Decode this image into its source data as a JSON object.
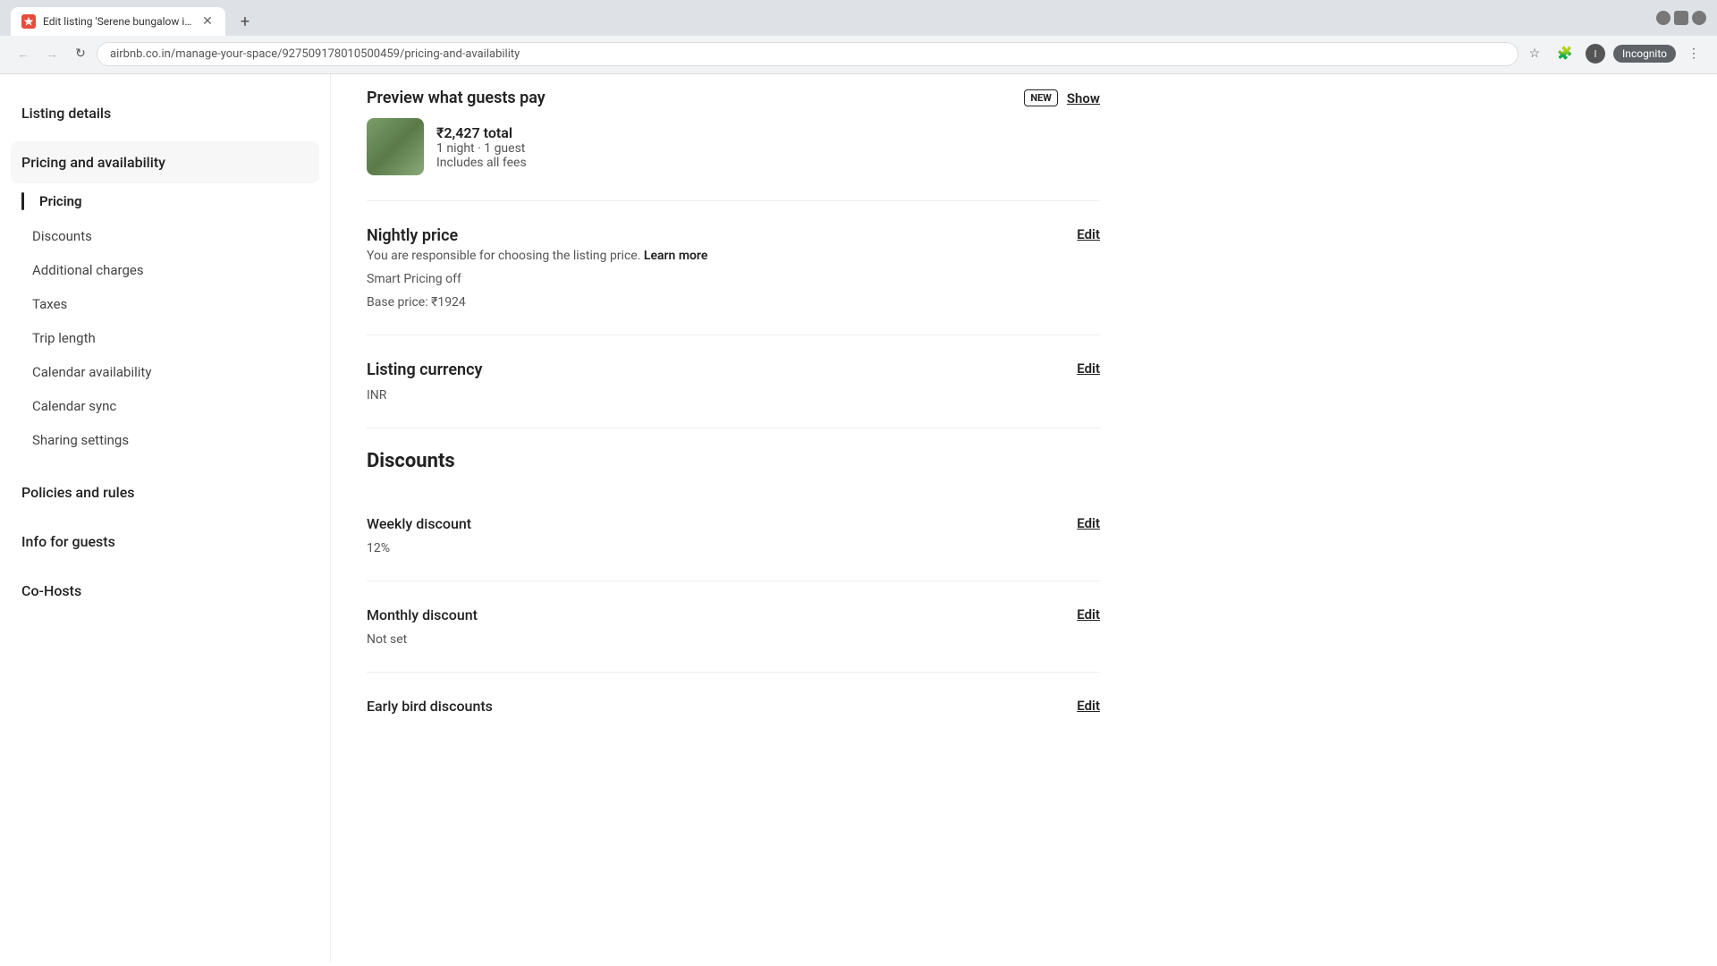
{
  "browser": {
    "tab_title": "Edit listing 'Serene bungalow in c...",
    "tab_favicon": "✈",
    "url": "airbnb.co.in/manage-your-space/927509178010500459/pricing-and-availability",
    "incognito_label": "Incognito"
  },
  "sidebar": {
    "listing_details_label": "Listing details",
    "pricing_availability_label": "Pricing and availability",
    "sub_items": [
      {
        "id": "pricing",
        "label": "Pricing",
        "active": true
      },
      {
        "id": "discounts",
        "label": "Discounts",
        "active": false
      },
      {
        "id": "additional_charges",
        "label": "Additional charges",
        "active": false
      },
      {
        "id": "taxes",
        "label": "Taxes",
        "active": false
      },
      {
        "id": "trip_length",
        "label": "Trip length",
        "active": false
      },
      {
        "id": "calendar_availability",
        "label": "Calendar availability",
        "active": false
      },
      {
        "id": "calendar_sync",
        "label": "Calendar sync",
        "active": false
      },
      {
        "id": "sharing_settings",
        "label": "Sharing settings",
        "active": false
      }
    ],
    "policies_rules_label": "Policies and rules",
    "info_guests_label": "Info for guests",
    "co_hosts_label": "Co-Hosts"
  },
  "main": {
    "preview_section": {
      "title": "Preview what guests pay",
      "new_badge": "NEW",
      "show_button": "Show",
      "price": "₹2,427 total",
      "stay_info": "1 night · 1 guest",
      "includes_fees": "Includes all fees"
    },
    "nightly_price_section": {
      "title": "Nightly price",
      "subtitle": "You are responsible for choosing the listing price.",
      "learn_more": "Learn more",
      "smart_pricing": "Smart Pricing off",
      "base_price": "Base price: ₹1924",
      "edit_label": "Edit"
    },
    "listing_currency_section": {
      "title": "Listing currency",
      "value": "INR",
      "edit_label": "Edit"
    },
    "discounts_section": {
      "heading": "Discounts"
    },
    "weekly_discount_section": {
      "title": "Weekly discount",
      "value": "12%",
      "edit_label": "Edit"
    },
    "monthly_discount_section": {
      "title": "Monthly discount",
      "value": "Not set",
      "edit_label": "Edit"
    },
    "early_bird_section": {
      "title": "Early bird discounts",
      "edit_label": "Edit"
    }
  }
}
